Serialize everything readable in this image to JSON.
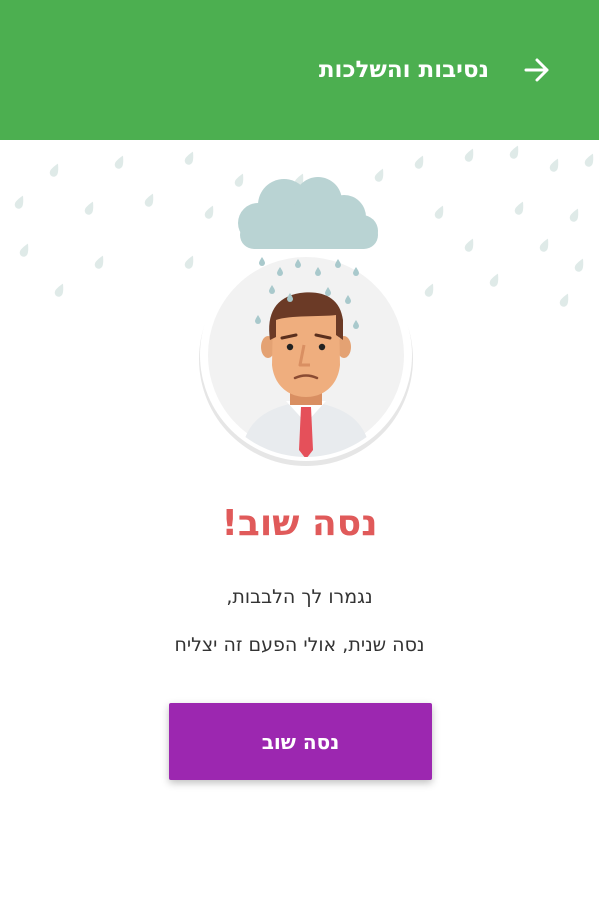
{
  "app_bar": {
    "title": "נסיבות והשלכות",
    "back_icon": "arrow-forward-icon",
    "color": "#4caf50"
  },
  "illustration": {
    "icons": [
      "rain-cloud-icon",
      "sad-man-avatar"
    ]
  },
  "result": {
    "headline": "נסה שוב!",
    "headline_color": "#e05a5a",
    "message_line_1": "נגמרו לך הלבבות,",
    "message_line_2": "נסה שנית, אולי הפעם זה יצליח"
  },
  "actions": {
    "retry_label": "נסה שוב",
    "retry_color": "#9c27b0"
  }
}
